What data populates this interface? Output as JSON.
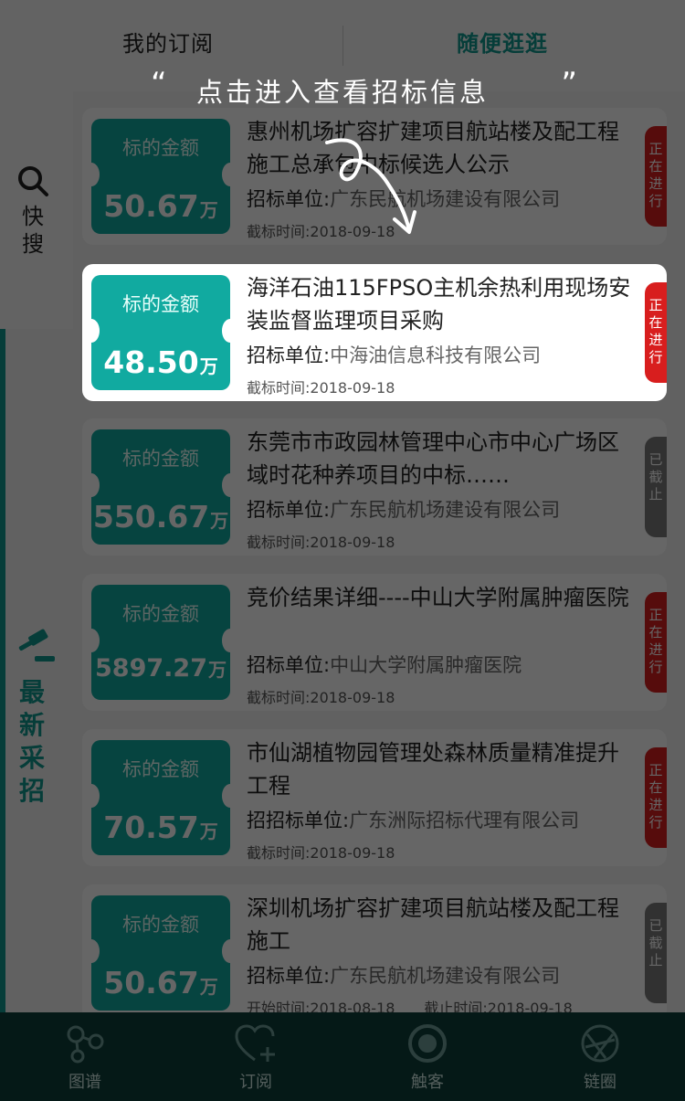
{
  "tabs": {
    "subscribe": "我的订阅",
    "browse": "随便逛逛"
  },
  "side": {
    "search_label": "快搜",
    "latest_label": "最新采招"
  },
  "cards": [
    {
      "label": "标的金额",
      "amount": "50.67",
      "unit": "万",
      "title": "惠州机场扩容扩建项目航站楼及配工程施工总承包中标候选人公示",
      "org_label": "招标单位:",
      "org_value": "广东民航机场建设有限公司",
      "date": "截标时间:2018-09-18",
      "status": "正在进行",
      "status_color": "#d81e1e"
    },
    {
      "label": "标的金额",
      "amount": "48.50",
      "unit": "万",
      "title": "海洋石油115FPSO主机余热利用现场安装监督监理项目采购",
      "org_label": "招标单位:",
      "org_value": "中海油信息科技有限公司",
      "date": "截标时间:2018-09-18",
      "status": "正在进行",
      "status_color": "#d81e1e"
    },
    {
      "label": "标的金额",
      "amount": "550.67",
      "unit": "万",
      "title": "东莞市市政园林管理中心市中心广场区域时花种养项目的中标……",
      "org_label": "招标单位:",
      "org_value": "广东民航机场建设有限公司",
      "date": "截标时间:2018-09-18",
      "status": "已截止",
      "status_color": "#7a7a7a"
    },
    {
      "label": "标的金额",
      "amount": "5897.27",
      "unit": "万",
      "title": "竞价结果详细----中山大学附属肿瘤医院",
      "org_label": "招标单位:",
      "org_value": "中山大学附属肿瘤医院",
      "date": "截标时间:2018-09-18",
      "status": "正在进行",
      "status_color": "#d81e1e"
    },
    {
      "label": "标的金额",
      "amount": "70.57",
      "unit": "万",
      "title": "市仙湖植物园管理处森林质量精准提升工程",
      "org_label": "招招标单位:",
      "org_value": "广东洲际招标代理有限公司",
      "date": "截标时间:2018-09-18",
      "status": "正在进行",
      "status_color": "#d81e1e"
    },
    {
      "label": "标的金额",
      "amount": "50.67",
      "unit": "万",
      "title": "深圳机场扩容扩建项目航站楼及配工程施工",
      "org_label": "招标单位:",
      "org_value": "广东民航机场建设有限公司",
      "date": "开始时间:2018-08-18　　截止时间:2018-09-18",
      "status": "已截止",
      "status_color": "#7a7a7a"
    }
  ],
  "bottom_nav": [
    {
      "label": "图谱",
      "icon": "graph-icon"
    },
    {
      "label": "订阅",
      "icon": "heart-plus-icon"
    },
    {
      "label": "触客",
      "icon": "circle-icon"
    },
    {
      "label": "链圈",
      "icon": "aperture-icon"
    }
  ],
  "overlay": {
    "quote_open": "“",
    "text": "点击进入查看招标信息",
    "quote_close": "”"
  }
}
